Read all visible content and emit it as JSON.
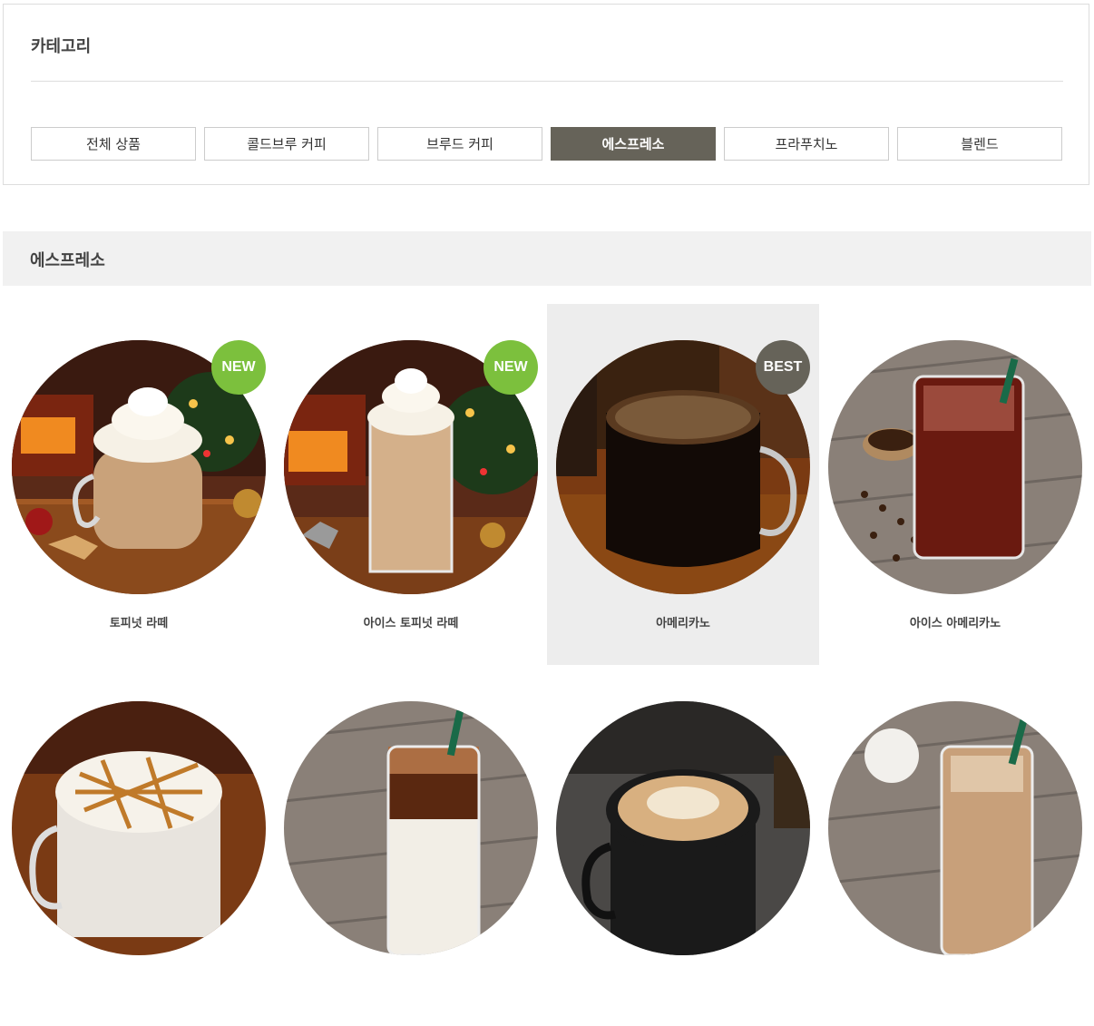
{
  "category": {
    "title": "카테고리",
    "tabs": [
      {
        "label": "전체 상품",
        "active": false
      },
      {
        "label": "콜드브루 커피",
        "active": false
      },
      {
        "label": "브루드 커피",
        "active": false
      },
      {
        "label": "에스프레소",
        "active": true
      },
      {
        "label": "프라푸치노",
        "active": false
      },
      {
        "label": "블렌드",
        "active": false
      }
    ]
  },
  "section": {
    "title": "에스프레소"
  },
  "products": [
    {
      "name": "토피넛 라떼",
      "badge": "NEW"
    },
    {
      "name": "아이스 토피넛 라떼",
      "badge": "NEW"
    },
    {
      "name": "아메리카노",
      "badge": "BEST"
    },
    {
      "name": "아이스 아메리카노",
      "badge": ""
    },
    {
      "name": "",
      "badge": ""
    },
    {
      "name": "",
      "badge": ""
    },
    {
      "name": "",
      "badge": ""
    },
    {
      "name": "",
      "badge": ""
    }
  ]
}
